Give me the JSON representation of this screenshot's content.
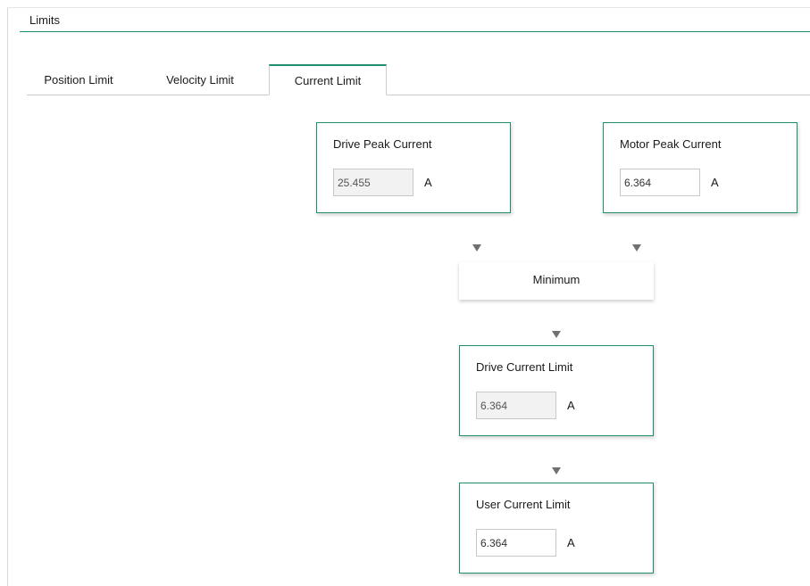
{
  "section": {
    "title": "Limits"
  },
  "tabs": [
    {
      "label": "Position Limit",
      "active": false
    },
    {
      "label": "Velocity Limit",
      "active": false
    },
    {
      "label": "Current Limit",
      "active": true
    }
  ],
  "cards": {
    "drive_peak": {
      "title": "Drive Peak Current",
      "value": "25.455",
      "unit": "A",
      "editable": false
    },
    "motor_peak": {
      "title": "Motor Peak Current",
      "value": "6.364",
      "unit": "A",
      "editable": true
    },
    "drive_limit": {
      "title": "Drive Current Limit",
      "value": "6.364",
      "unit": "A",
      "editable": false
    },
    "user_limit": {
      "title": "User Current Limit",
      "value": "6.364",
      "unit": "A",
      "editable": true
    }
  },
  "minimum": {
    "label": "Minimum"
  },
  "colors": {
    "accent": "#1f8f70",
    "arrow": "#707070"
  },
  "icons": {
    "flow_arrow": "triangle-down"
  }
}
